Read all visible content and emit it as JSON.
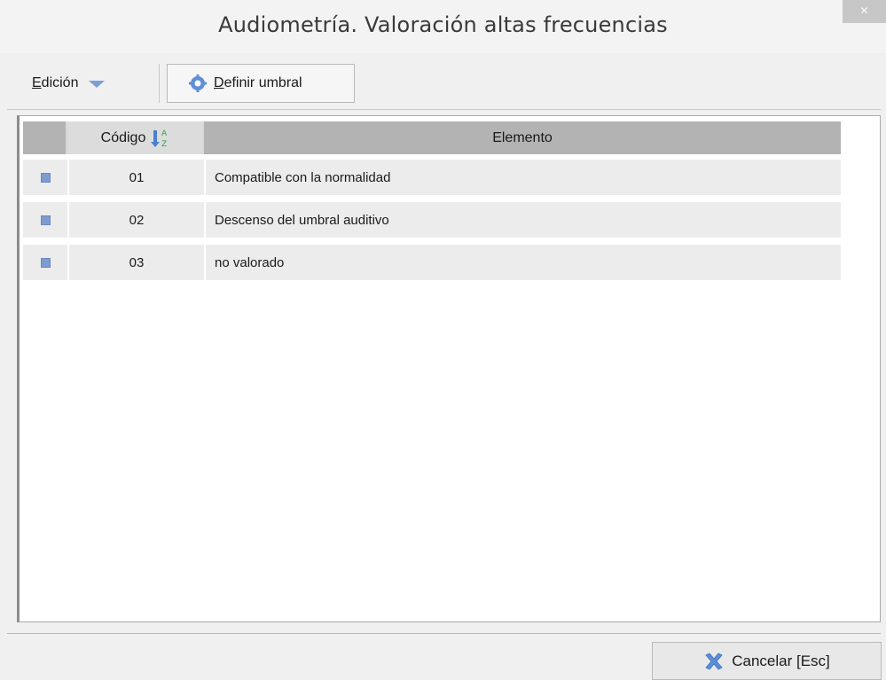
{
  "window": {
    "title": "Audiometría. Valoración altas frecuencias",
    "close_label": "×"
  },
  "toolbar": {
    "edicion_label": "Edición",
    "definir_label": "Definir umbral"
  },
  "grid": {
    "columns": [
      "Código",
      "Elemento"
    ],
    "rows": [
      {
        "codigo": "01",
        "elemento": "Compatible con la normalidad"
      },
      {
        "codigo": "02",
        "elemento": "Descenso del umbral auditivo"
      },
      {
        "codigo": "03",
        "elemento": "no valorado"
      }
    ]
  },
  "footer": {
    "cancel_label": "Cancelar [Esc]"
  },
  "colors": {
    "accent": "#7d9bd0",
    "header_bg": "#b3b3b3",
    "row_bg": "#ececec"
  }
}
